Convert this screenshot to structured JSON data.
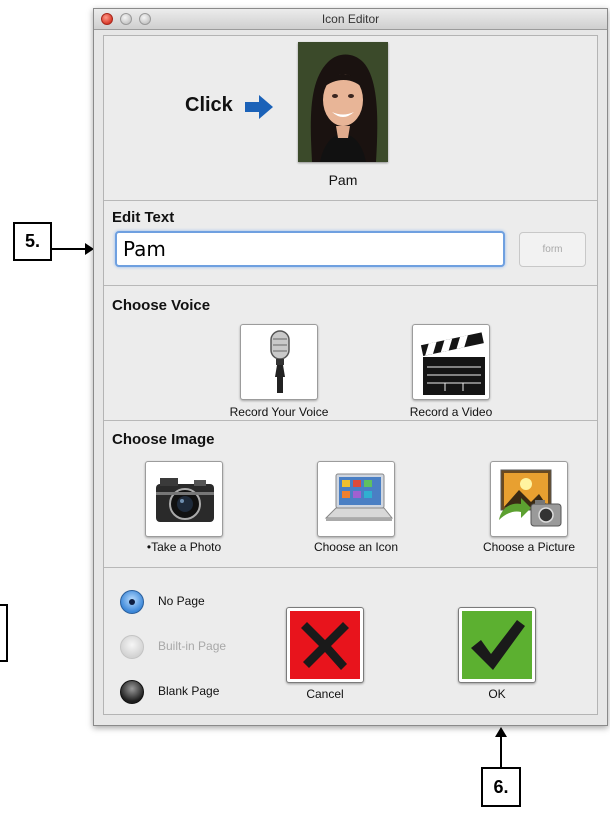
{
  "window": {
    "title": "Icon Editor"
  },
  "header": {
    "click_label": "Click",
    "portrait_name": "Pam"
  },
  "edit_text": {
    "heading": "Edit Text",
    "value": "Pam",
    "form_button": "form"
  },
  "choose_voice": {
    "heading": "Choose Voice",
    "options": [
      {
        "label": "Record Your Voice",
        "icon": "microphone-icon"
      },
      {
        "label": "Record a Video",
        "icon": "clapperboard-icon"
      }
    ]
  },
  "choose_image": {
    "heading": "Choose Image",
    "options": [
      {
        "label": "•Take a Photo",
        "icon": "camera-icon"
      },
      {
        "label": "Choose an Icon",
        "icon": "laptop-icon"
      },
      {
        "label": "Choose a Picture",
        "icon": "picture-camera-icon"
      }
    ]
  },
  "page_options": [
    {
      "label": "No Page",
      "state": "selected"
    },
    {
      "label": "Built-in Page",
      "state": "disabled"
    },
    {
      "label": "Blank Page",
      "state": "unselected"
    }
  ],
  "actions": {
    "cancel_label": "Cancel",
    "ok_label": "OK"
  },
  "callouts": {
    "step5": "5.",
    "step6": "6."
  },
  "colors": {
    "cancel": "#e8141c",
    "ok": "#5cb030",
    "focus": "#6fa0e0",
    "arrow": "#1b62b8"
  }
}
